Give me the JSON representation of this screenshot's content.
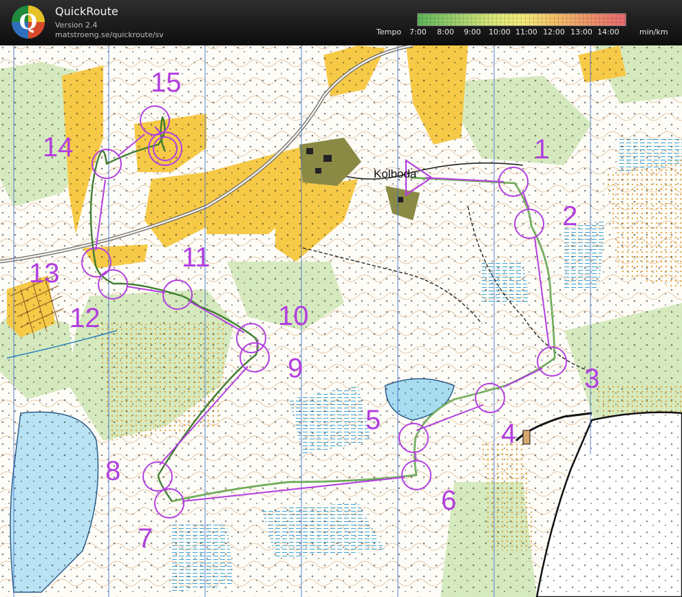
{
  "header": {
    "app_name": "QuickRoute",
    "version": "Version 2.4",
    "url": "matstroeng.se/quickroute/sv",
    "logo_letter": "Q"
  },
  "tempo_legend": {
    "label": "Tempo",
    "ticks": [
      "7:00",
      "8:00",
      "9:00",
      "10:00",
      "11:00",
      "12:00",
      "13:00",
      "14:00"
    ],
    "unit": "min/km",
    "colors": [
      "#5fb45a",
      "#9ccf6d",
      "#d7e679",
      "#f3ed7a",
      "#f3c36a",
      "#ef9a6a",
      "#e9696e"
    ]
  },
  "map": {
    "place_name": "Kolboda",
    "course_color": "#b23fe0",
    "route_color": "#3d7d30",
    "start_label": "start",
    "controls": [
      {
        "number": "1"
      },
      {
        "number": "2"
      },
      {
        "number": "3"
      },
      {
        "number": "4"
      },
      {
        "number": "5"
      },
      {
        "number": "6"
      },
      {
        "number": "7"
      },
      {
        "number": "8"
      },
      {
        "number": "9"
      },
      {
        "number": "10"
      },
      {
        "number": "11"
      },
      {
        "number": "12"
      },
      {
        "number": "13"
      },
      {
        "number": "14"
      },
      {
        "number": "15"
      }
    ]
  }
}
